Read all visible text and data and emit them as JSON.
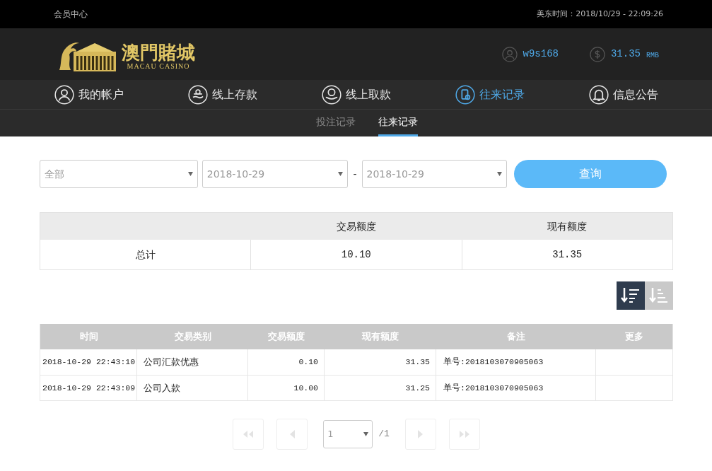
{
  "top_bar": {
    "title": "会员中心",
    "clock": "美东时间：2018/10/29 - 22:09:26"
  },
  "header": {
    "logo_title": "澳門賭城",
    "logo_subtitle": "MACAU CASINO",
    "username": "w9s168",
    "balance": "31.35",
    "currency": "RMB"
  },
  "nav": [
    {
      "label": "我的帐户",
      "selected": false
    },
    {
      "label": "线上存款",
      "selected": false
    },
    {
      "label": "线上取款",
      "selected": false
    },
    {
      "label": "往来记录",
      "selected": true
    },
    {
      "label": "信息公告",
      "selected": false
    }
  ],
  "sub_tabs": [
    {
      "label": "投注记录",
      "selected": false
    },
    {
      "label": "往来记录",
      "selected": true
    }
  ],
  "filters": {
    "type": "全部",
    "date_from": "2018-10-29",
    "separator": "-",
    "date_to": "2018-10-29",
    "search_button": "查询"
  },
  "summary": {
    "columns": [
      "交易额度",
      "现有额度"
    ],
    "rows": [
      {
        "label": "总计",
        "values": [
          "10.10",
          "31.35"
        ]
      }
    ]
  },
  "sort_buttons": [
    {
      "kind": "descending",
      "selected": true
    },
    {
      "kind": "ascending",
      "selected": false
    }
  ],
  "records": {
    "columns": [
      "时间",
      "交易类别",
      "交易额度",
      "现有额度",
      "备注",
      "更多"
    ],
    "rows": [
      [
        "2018-10-29 22:43:10",
        "公司汇款优惠",
        "0.10",
        "31.35",
        "单号:2018103070905063",
        ""
      ],
      [
        "2018-10-29 22:43:09",
        "公司入款",
        "10.00",
        "31.25",
        "单号:2018103070905063",
        ""
      ]
    ]
  },
  "pager": {
    "buttons": [
      {
        "kind": "first",
        "disabled": true
      },
      {
        "kind": "prev",
        "disabled": true
      },
      {
        "kind": "page",
        "value": "1",
        "total": "/1"
      },
      {
        "kind": "next",
        "disabled": true
      },
      {
        "kind": "last",
        "disabled": true
      }
    ]
  }
}
